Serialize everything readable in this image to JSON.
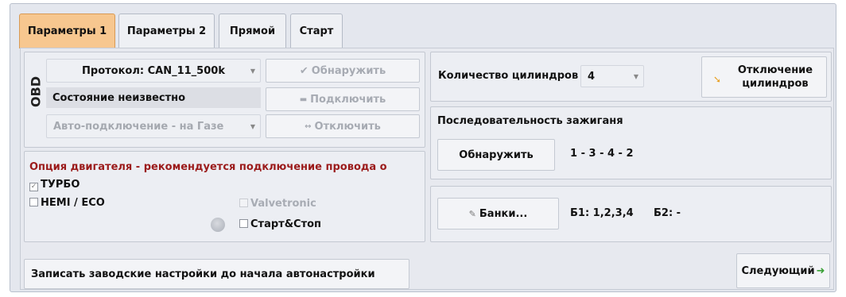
{
  "tabs": [
    {
      "label": "Параметры 1",
      "active": true
    },
    {
      "label": "Параметры 2",
      "active": false
    },
    {
      "label": "Прямой",
      "active": false
    },
    {
      "label": "Старт",
      "active": false
    }
  ],
  "obd": {
    "title": "OBD",
    "protocol": "Протокол: CAN_11_500k",
    "state": "Состояние неизвестно",
    "autoconnect": "Авто-подключение - на Газе",
    "detect_label": "Обнаружить",
    "connect_label": "Подключить",
    "disconnect_label": "Отключить"
  },
  "engine_option": {
    "warning": "Опция двигателя - рекомендуется подключение провода о",
    "turbo": {
      "label": "ТУРБО",
      "checked": true
    },
    "hemi": {
      "label": "HEMI / ECO",
      "checked": false
    },
    "valvetronic": {
      "label": "Valvetronic",
      "checked": false,
      "enabled": false
    },
    "startstop": {
      "label": "Старт&Стоп",
      "checked": false
    }
  },
  "cylinders": {
    "label": "Количество цилиндров",
    "value": "4",
    "disable_label_line1": "Отключение",
    "disable_label_line2": "цилиндров"
  },
  "firing": {
    "title": "Последовательность зажиганя",
    "detect_label": "Обнаружить",
    "order": "1 - 3 - 4 - 2"
  },
  "banks": {
    "button_label": "Банки...",
    "b1": "Б1: 1,2,3,4",
    "b2": "Б2: -"
  },
  "footer": {
    "factory_label": "Записать заводские настройки до начала автонастройки",
    "next_label": "Следующий"
  },
  "colors": {
    "active_tab": "#f7c78f",
    "warning_text": "#9b1b1b",
    "next_arrow": "#39a035",
    "tool_icon": "#e8a126"
  }
}
